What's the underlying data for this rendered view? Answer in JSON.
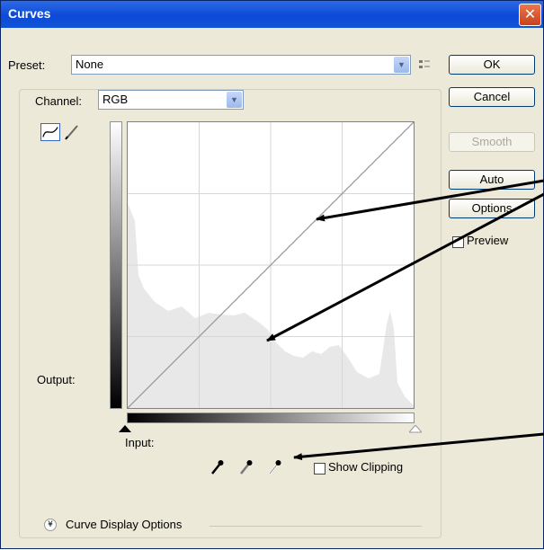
{
  "window": {
    "title": "Curves",
    "close_glyph": "✕"
  },
  "preset": {
    "label": "Preset:",
    "value": "None"
  },
  "channel": {
    "label": "Channel:",
    "value": "RGB"
  },
  "buttons": {
    "ok": "OK",
    "cancel": "Cancel",
    "smooth": "Smooth",
    "auto": "Auto",
    "options": "Options"
  },
  "preview": {
    "label": "Preview",
    "checked": false
  },
  "graph": {
    "output_label": "Output:",
    "input_label": "Input:"
  },
  "show_clipping": {
    "label": "Show Clipping",
    "checked": false
  },
  "curve_display": {
    "label": "Curve Display Options",
    "toggle_glyph": "¥"
  },
  "preset_options_icon": "preset-options-icon",
  "colors": {
    "titlebar": "#0c4ad8",
    "dialog_bg": "#ece9d8",
    "arrow": "#000000",
    "histogram": "#e8e8e8",
    "grid": "#d7d7d7"
  }
}
